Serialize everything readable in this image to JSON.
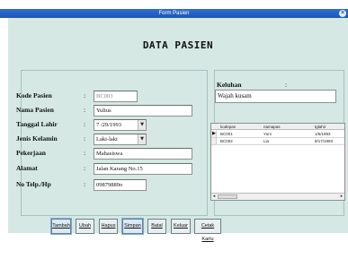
{
  "window": {
    "title": "Form Pasien"
  },
  "heading": "DATA PASIEN",
  "form": {
    "fields": [
      {
        "label": "Kode Pasien",
        "value": "BC003",
        "muted": true
      },
      {
        "label": "Nama Pasien",
        "value": "Yulius"
      },
      {
        "label": "Tanggal Lahir",
        "value": "7 /29/1993",
        "type": "combo"
      },
      {
        "label": "Jenis Kelamin",
        "value": "Laki-laki",
        "type": "combo"
      },
      {
        "label": "Pekerjaan",
        "value": "Mahasiswa"
      },
      {
        "label": "Alamat",
        "value": "Jalan Karang No.15"
      },
      {
        "label": "No Telp./Hp",
        "value": "09879889o"
      }
    ],
    "colon": ":"
  },
  "keluhan": {
    "label": "Keluhan",
    "colon": ":",
    "value": "Wajah kusam"
  },
  "grid": {
    "columns": [
      "kodepas",
      "namapas",
      "tglahir"
    ],
    "rows": [
      [
        "BC001",
        "Yuni",
        "1/6/1993"
      ],
      [
        "BC002",
        "Lia",
        "8/17/1993"
      ]
    ],
    "pointer": "▶",
    "scroll_left": "◂",
    "scroll_right": "▸"
  },
  "buttons": [
    {
      "label": "Tambah",
      "state": "focused"
    },
    {
      "label": "Ubah"
    },
    {
      "label": "Hapus"
    },
    {
      "label": "Simpan",
      "state": "focused"
    },
    {
      "label": "Batal"
    },
    {
      "label": "Keluar"
    },
    {
      "label": "Cetak Kartu"
    }
  ],
  "colors": {
    "titlebar": "#1e55b5",
    "client": "#d5e8e4"
  }
}
